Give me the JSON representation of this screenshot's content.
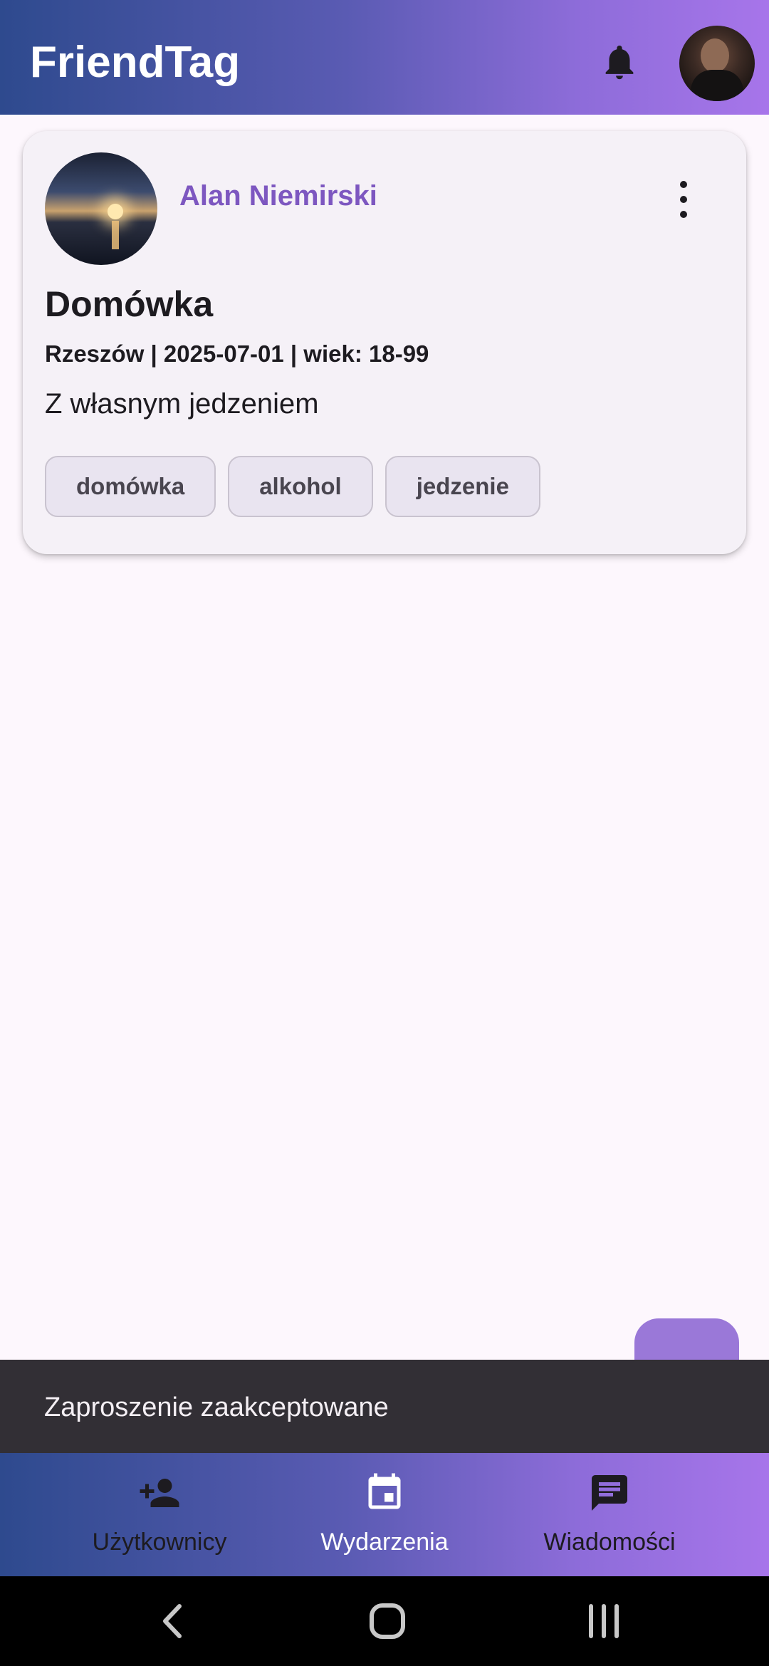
{
  "app": {
    "title": "FriendTag"
  },
  "header": {
    "notifications_icon": "bell-icon",
    "profile_avatar": "profile-avatar"
  },
  "event_card": {
    "author": "Alan Niemirski",
    "title": "Domówka",
    "meta": "Rzeszów | 2025-07-01 | wiek: 18-99",
    "description": "Z własnym jedzeniem",
    "tags": [
      "domówka",
      "alkohol",
      "jedzenie"
    ],
    "menu_icon": "more-vert-icon"
  },
  "snackbar": {
    "message": "Zaproszenie zaakceptowane"
  },
  "bottom_nav": {
    "items": [
      {
        "label": "Użytkownicy",
        "icon": "person-add-icon",
        "color": "#1d1b20"
      },
      {
        "label": "Wydarzenia",
        "icon": "calendar-icon",
        "color": "#ffffff"
      },
      {
        "label": "Wiadomości",
        "icon": "message-icon",
        "color": "#1d1b20"
      }
    ]
  },
  "colors": {
    "accent": "#7d57c0",
    "gradient_start": "#2e4a8e",
    "gradient_end": "#a775ea",
    "background": "#fdf7fd",
    "fab": "#9a78d8",
    "snackbar": "#322f35"
  }
}
